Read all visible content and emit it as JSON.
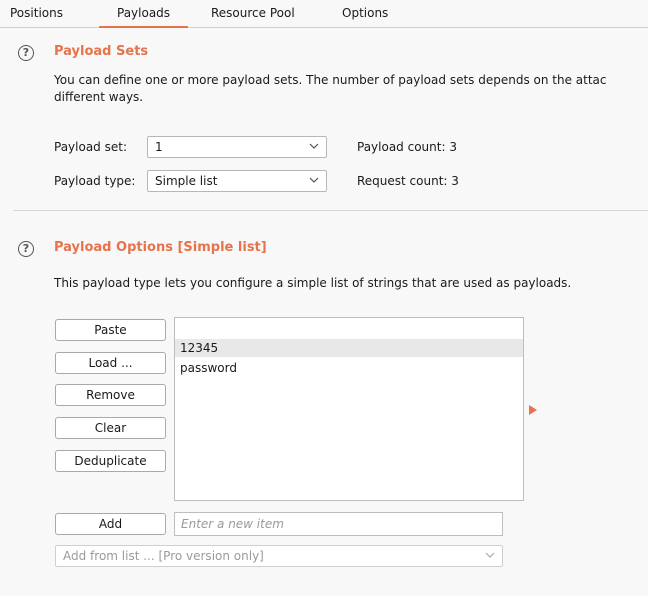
{
  "tabs": [
    {
      "label": "Positions"
    },
    {
      "label": "Payloads"
    },
    {
      "label": "Resource Pool"
    },
    {
      "label": "Options"
    }
  ],
  "help_glyph": "?",
  "payload_sets": {
    "title": "Payload Sets",
    "description_line1": "You can define one or more payload sets. The number of payload sets depends on the attac",
    "description_line2": "different ways.",
    "set_label": "Payload set:",
    "set_value": "1",
    "type_label": "Payload type:",
    "type_value": "Simple list",
    "payload_count": "Payload count: 3",
    "request_count": "Request count: 3"
  },
  "payload_options": {
    "title": "Payload Options [Simple list]",
    "description": "This payload type lets you configure a simple list of strings that are used as payloads.",
    "buttons": {
      "paste": "Paste",
      "load": "Load ...",
      "remove": "Remove",
      "clear": "Clear",
      "deduplicate": "Deduplicate",
      "add": "Add"
    },
    "list_items": [
      "",
      "12345",
      "password"
    ],
    "new_item_placeholder": "Enter a new item",
    "add_from_list": "Add from list ... [Pro version only]"
  },
  "colors": {
    "accent": "#e8734a",
    "background": "#f8f8f8"
  }
}
